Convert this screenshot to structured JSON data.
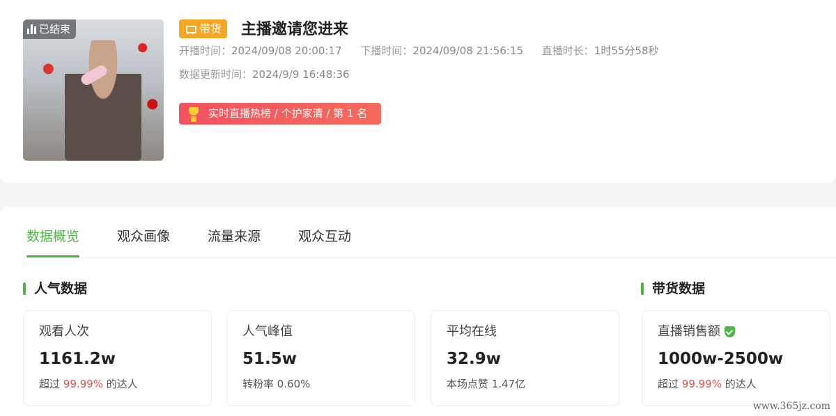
{
  "header": {
    "status_badge": "已结束",
    "tag": "带货",
    "title": "主播邀请您进来",
    "start_label": "开播时间：",
    "start_time": "2024/09/08 20:00:17",
    "end_label": "下播时间：",
    "end_time": "2024/09/08 21:56:15",
    "duration_label": "直播时长：",
    "duration": "1时55分58秒",
    "update_label": "数据更新时间：",
    "update_time": "2024/9/9 16:48:36",
    "rank_text": "实时直播热榜 / 个护家清 / 第 1 名"
  },
  "tabs": [
    {
      "label": "数据概览",
      "active": true
    },
    {
      "label": "观众画像",
      "active": false
    },
    {
      "label": "流量来源",
      "active": false
    },
    {
      "label": "观众互动",
      "active": false
    }
  ],
  "sections": {
    "popularity_title": "人气数据",
    "sales_title": "带货数据"
  },
  "stats": [
    {
      "label": "观看人次",
      "value": "1161.2w",
      "sub_prefix": "超过 ",
      "sub_highlight": "99.99%",
      "sub_suffix": " 的达人"
    },
    {
      "label": "人气峰值",
      "value": "51.5w",
      "sub_prefix": "转粉率 0.60%",
      "sub_highlight": "",
      "sub_suffix": ""
    },
    {
      "label": "平均在线",
      "value": "32.9w",
      "sub_prefix": "本场点赞 1.47亿",
      "sub_highlight": "",
      "sub_suffix": ""
    },
    {
      "label": "直播销售额",
      "value": "1000w-2500w",
      "sub_prefix": "超过 ",
      "sub_highlight": "99.99%",
      "sub_suffix": " 的达人"
    }
  ],
  "watermark": "www.365jz.com",
  "colors": {
    "accent": "#4cb944",
    "tag": "#f5a623",
    "rank": "#f4515f",
    "highlight": "#e84d4d"
  }
}
